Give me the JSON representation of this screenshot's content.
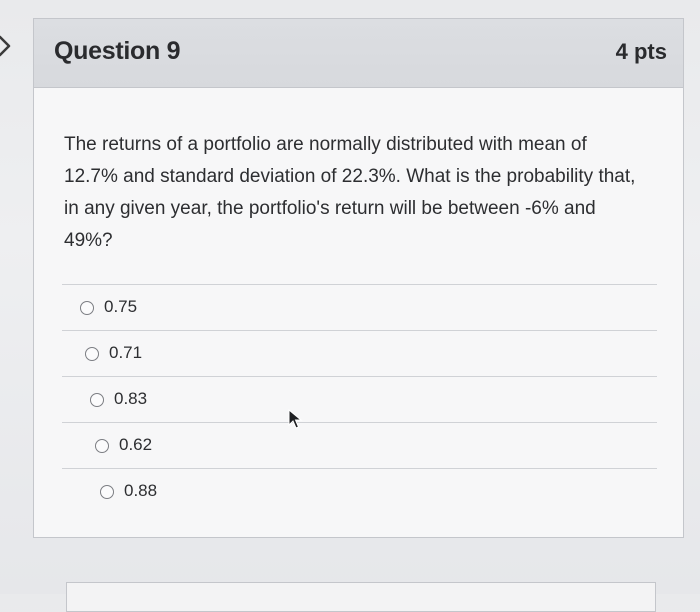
{
  "question": {
    "title": "Question 9",
    "points": "4 pts",
    "text": "The returns of a portfolio are normally distributed with mean of 12.7% and standard deviation of 22.3%. What is the probability that, in any given year, the portfolio's return will be between -6% and 49%?"
  },
  "answers": [
    {
      "label": "0.75",
      "selected": false
    },
    {
      "label": "0.71",
      "selected": false
    },
    {
      "label": "0.83",
      "selected": false
    },
    {
      "label": "0.62",
      "selected": false
    },
    {
      "label": "0.88",
      "selected": false
    }
  ],
  "icons": {
    "nav": "chevron-right-icon",
    "cursor": "mouse-cursor-icon",
    "answer_option": "radio-button-icon"
  }
}
